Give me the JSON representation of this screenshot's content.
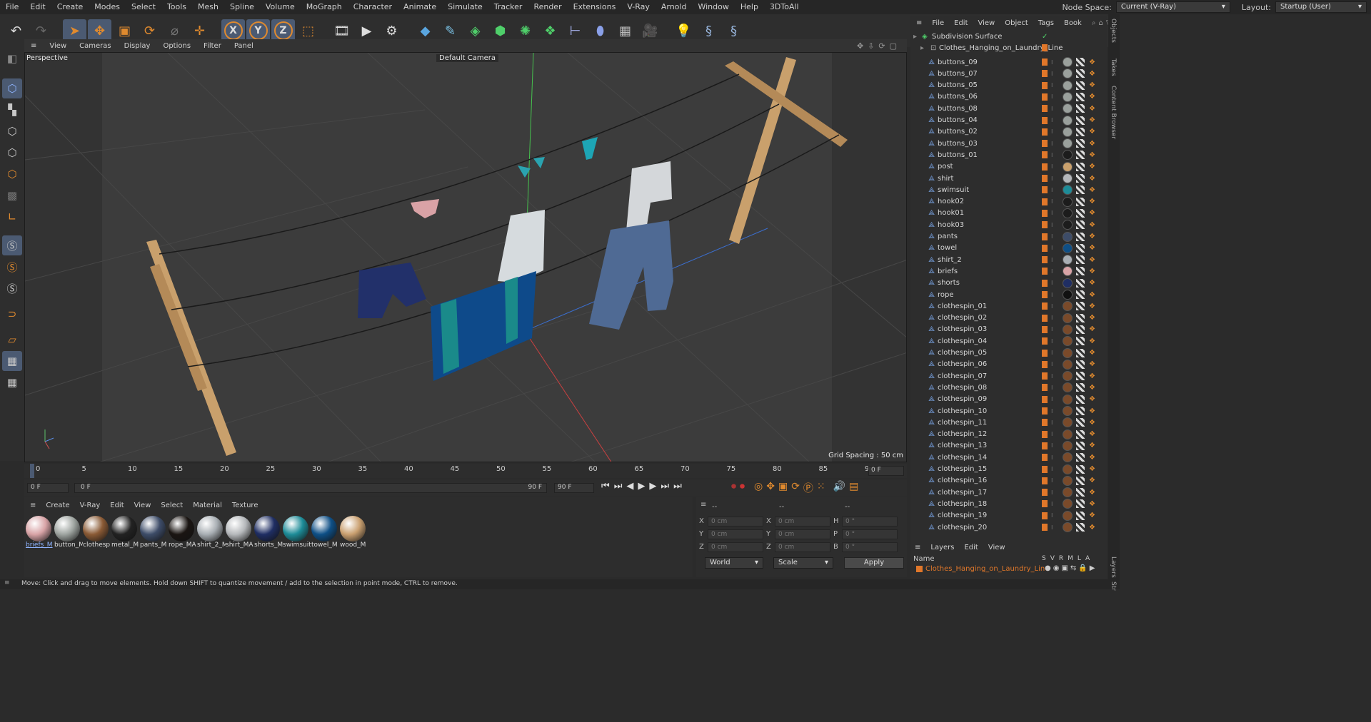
{
  "menubar": {
    "items": [
      "File",
      "Edit",
      "Create",
      "Modes",
      "Select",
      "Tools",
      "Mesh",
      "Spline",
      "Volume",
      "MoGraph",
      "Character",
      "Animate",
      "Simulate",
      "Tracker",
      "Render",
      "Extensions",
      "V-Ray",
      "Arnold",
      "Window",
      "Help",
      "3DToAll"
    ],
    "node_space_label": "Node Space:",
    "node_space_value": "Current (V-Ray)",
    "layout_label": "Layout:",
    "layout_value": "Startup (User)"
  },
  "toolbar": {
    "icons": [
      "undo-icon",
      "redo-icon",
      "select-icon",
      "move-icon",
      "scale-icon",
      "rotate-icon",
      "recent-icon",
      "add-icon",
      "x-axis-icon",
      "y-axis-icon",
      "z-axis-icon",
      "world-coord-icon",
      "render-region-icon",
      "render-view-icon",
      "render-settings-icon",
      "cube-icon",
      "pen-icon",
      "subdivision-icon",
      "extrude-icon",
      "cloner-icon",
      "array-icon",
      "deformer-icon",
      "field-icon",
      "floor-icon",
      "camera-icon",
      "light-icon",
      "python-icon",
      "python2-icon"
    ],
    "axis_x": "X",
    "axis_y": "Y",
    "axis_z": "Z"
  },
  "viewport": {
    "menu": [
      "View",
      "Cameras",
      "Display",
      "Options",
      "Filter",
      "Panel"
    ],
    "label": "Perspective",
    "camera": "Default Camera",
    "grid_spacing": "Grid Spacing : 50 cm"
  },
  "timeline": {
    "ticks": [
      "0",
      "5",
      "10",
      "15",
      "20",
      "25",
      "30",
      "35",
      "40",
      "45",
      "50",
      "55",
      "60",
      "65",
      "70",
      "75",
      "80",
      "85",
      "90"
    ],
    "end_field": "0 F",
    "current_frame": "0 F",
    "range_start": "0 F",
    "range_end": "90 F",
    "max_frame": "90 F"
  },
  "material_manager": {
    "menu": [
      "Create",
      "V-Ray",
      "Edit",
      "View",
      "Select",
      "Material",
      "Texture"
    ],
    "materials": [
      {
        "name": "briefs_M",
        "color": "#d8a3a6"
      },
      {
        "name": "button_M",
        "color": "#9ea4a0"
      },
      {
        "name": "clothesp",
        "color": "#8a5a35"
      },
      {
        "name": "metal_M",
        "color": "#222"
      },
      {
        "name": "pants_M",
        "color": "#3d4c68"
      },
      {
        "name": "rope_MA",
        "color": "#1a1512"
      },
      {
        "name": "shirt_2_M",
        "color": "#a8aeb3"
      },
      {
        "name": "shirt_MA",
        "color": "#b5b8bb"
      },
      {
        "name": "shorts_M",
        "color": "#1f2e63"
      },
      {
        "name": "swimsuit",
        "color": "#1d8c98"
      },
      {
        "name": "towel_M",
        "color": "#0e4f86"
      },
      {
        "name": "wood_M",
        "color": "#caa070"
      }
    ]
  },
  "coordinates": {
    "headers": [
      "--",
      "--",
      "--"
    ],
    "rows": [
      {
        "l1": "X",
        "v1": "0 cm",
        "l2": "X",
        "v2": "0 cm",
        "l3": "H",
        "v3": "0 °"
      },
      {
        "l1": "Y",
        "v1": "0 cm",
        "l2": "Y",
        "v2": "0 cm",
        "l3": "P",
        "v3": "0 °"
      },
      {
        "l1": "Z",
        "v1": "0 cm",
        "l2": "Z",
        "v2": "0 cm",
        "l3": "B",
        "v3": "0 °"
      }
    ],
    "space": "World",
    "mode": "Scale",
    "apply": "Apply"
  },
  "objects": {
    "menu": [
      "File",
      "Edit",
      "View",
      "Object",
      "Tags",
      "Book"
    ],
    "root": "Subdivision Surface",
    "group": "Clothes_Hanging_on_Laundry_Line",
    "items": [
      "buttons_09",
      "buttons_07",
      "buttons_05",
      "buttons_06",
      "buttons_08",
      "buttons_04",
      "buttons_02",
      "buttons_03",
      "buttons_01",
      "post",
      "shirt",
      "swimsuit",
      "hook02",
      "hook01",
      "hook03",
      "pants",
      "towel",
      "shirt_2",
      "briefs",
      "shorts",
      "rope",
      "clothespin_01",
      "clothespin_02",
      "clothespin_03",
      "clothespin_04",
      "clothespin_05",
      "clothespin_06",
      "clothespin_07",
      "clothespin_08",
      "clothespin_09",
      "clothespin_10",
      "clothespin_11",
      "clothespin_12",
      "clothespin_13",
      "clothespin_14",
      "clothespin_15",
      "clothespin_16",
      "clothespin_17",
      "clothespin_18",
      "clothespin_19",
      "clothespin_20"
    ],
    "tagcolors": [
      "#9aa09c",
      "#9aa09c",
      "#9aa09c",
      "#9aa09c",
      "#9aa09c",
      "#9aa09c",
      "#9aa09c",
      "#9aa09c",
      "#1c1c1c",
      "#c9a06c",
      "#b4b7ba",
      "#1d8c98",
      "#1c1c1c",
      "#1c1c1c",
      "#1c1c1c",
      "#3d4c68",
      "#0e4f86",
      "#a8aeb3",
      "#d8a3a6",
      "#1f2e63",
      "#111111",
      "#7a4a2a",
      "#7a4a2a",
      "#7a4a2a",
      "#7a4a2a",
      "#7a4a2a",
      "#7a4a2a",
      "#7a4a2a",
      "#7a4a2a",
      "#7a4a2a",
      "#7a4a2a",
      "#7a4a2a",
      "#7a4a2a",
      "#7a4a2a",
      "#7a4a2a",
      "#7a4a2a",
      "#7a4a2a",
      "#7a4a2a",
      "#7a4a2a",
      "#7a4a2a",
      "#7a4a2a"
    ]
  },
  "layers": {
    "menu": [
      "Layers",
      "Edit",
      "View"
    ],
    "name_header": "Name",
    "cols": [
      "S",
      "V",
      "R",
      "M",
      "L",
      "A"
    ],
    "layer_name": "Clothes_Hanging_on_Laundry_Line"
  },
  "right_tabs": [
    "Objects",
    "Takes",
    "Content Browser",
    "Layers",
    "Str"
  ],
  "status": "Move: Click and drag to move elements. Hold down SHIFT to quantize movement / add to the selection in point mode, CTRL to remove.",
  "colors": {
    "accent": "#e08a2e",
    "selection": "#4b5a72",
    "layer_orange": "#e0772a"
  }
}
